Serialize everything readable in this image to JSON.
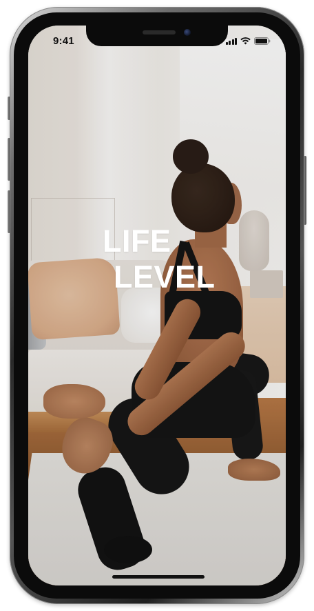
{
  "status_bar": {
    "time": "9:41",
    "icons": [
      "cellular-signal-icon",
      "wifi-icon",
      "battery-icon"
    ]
  },
  "splash": {
    "title_line_1": "LIFE",
    "title_line_2": "LEVEL",
    "background_image": "woman-doing-yoga-stretch-photo"
  },
  "colors": {
    "title_text": "#ffffff",
    "status_text": "#111111",
    "home_indicator": "#111111"
  }
}
